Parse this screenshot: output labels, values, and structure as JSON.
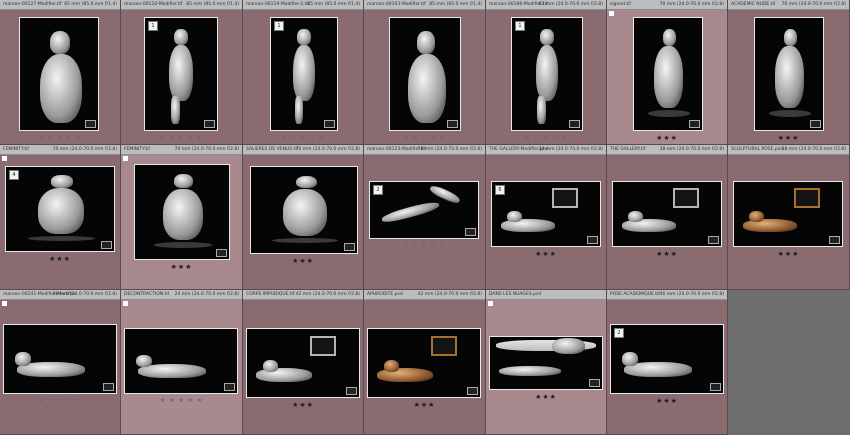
{
  "cells": [
    {
      "file": "maroon-00127-Modifier.tif",
      "lens": "85 mm (85.0 mm f/1.4)",
      "num": "",
      "stars": "★ ★ ★ ★ ★",
      "rated": false,
      "bg": "dark",
      "pose": "portrait"
    },
    {
      "file": "maroon-00110-Modifier.tif",
      "lens": "85 mm (85.0 mm f/1.4)",
      "num": "1",
      "stars": "★ ★ ★ ★ ★",
      "rated": false,
      "bg": "dark",
      "pose": "stool"
    },
    {
      "file": "maroon-00119-Modifier-2.tif",
      "lens": "85 mm (85.0 mm f/1.4)",
      "num": "1",
      "stars": "★ ★ ★ ★ ★",
      "rated": false,
      "bg": "dark",
      "pose": "seated"
    },
    {
      "file": "maroon-00103-Modifier.tif",
      "lens": "85 mm (85.0 mm f/1.4)",
      "num": "",
      "stars": "★ ★ ★ ★ ★",
      "rated": false,
      "bg": "dark",
      "pose": "portrait2"
    },
    {
      "file": "maroon-00186-Modifier.tif",
      "lens": "62 mm (24.0-70.0 mm f/2.8)",
      "num": "1",
      "stars": "★ ★ ★ ★ ★",
      "rated": false,
      "bg": "dark",
      "pose": "standing"
    },
    {
      "file": "signed.tif",
      "lens": "70 mm (24.0-70.0 mm f/2.8)",
      "num": "",
      "stars": "★★★",
      "rated": true,
      "bg": "light",
      "pose": "back"
    },
    {
      "file": "ACADEMIC NUDE.tif",
      "lens": "70 mm (24.0-70.0 mm f/2.8)",
      "num": "",
      "stars": "★★★",
      "rated": true,
      "bg": "dark",
      "pose": "back"
    },
    {
      "file": "FEMINITY.tif",
      "lens": "70 mm (24.0-70.0 mm f/2.8)",
      "num": "4",
      "stars": "★★★",
      "rated": true,
      "bg": "dark",
      "pose": "back2"
    },
    {
      "file": "FEMINITY.tif",
      "lens": "70 mm (24.0-70.0 mm f/2.8)",
      "num": "",
      "stars": "★★★",
      "rated": true,
      "bg": "light",
      "pose": "back2"
    },
    {
      "file": "SALIERES DE VENUS.tif",
      "lens": "70 mm (24.0-70.0 mm f/2.8)",
      "num": "",
      "stars": "★★★",
      "rated": true,
      "bg": "dark",
      "pose": "back2"
    },
    {
      "file": "maroon-00123-Modifier.tif",
      "lens": "78 mm (24.0-70.0 mm f/2.8)",
      "num": "2",
      "stars": "★ ★ ★ ★ ★",
      "rated": false,
      "bg": "dark",
      "pose": "legs"
    },
    {
      "file": "THE GALLERY-Modifier.psd",
      "lens": "38 mm (24.0-70.0 mm f/2.8)",
      "num": "6",
      "stars": "★★★",
      "rated": true,
      "bg": "dark",
      "pose": "gallery"
    },
    {
      "file": "THE GALLERY.tif",
      "lens": "38 mm (24.0-70.0 mm f/2.8)",
      "num": "",
      "stars": "★★★",
      "rated": true,
      "bg": "dark",
      "pose": "gallery"
    },
    {
      "file": "SCULPTURAL POSE.psd",
      "lens": "38 mm (24.0-70.0 mm f/2.8)",
      "num": "",
      "stars": "★★★",
      "rated": true,
      "bg": "dark",
      "pose": "goldgallery"
    },
    {
      "file": "maroon-00241-Modifier-Modifier.tif",
      "lens": "38 mm (24.0-70.0 mm f/2.8)",
      "num": "",
      "stars": "★ ★ ★ ★ ★",
      "rated": false,
      "bg": "dark",
      "pose": "reclining"
    },
    {
      "file": "DECONTRACTION.tif",
      "lens": "24 mm (24.0-70.0 mm f/2.8)",
      "num": "",
      "stars": "★ ★ ★ ★ ★",
      "rated": false,
      "bg": "light",
      "pose": "reclining"
    },
    {
      "file": "CORPS IMPUDIQUE.tif",
      "lens": "42 mm (24.0-70.0 mm f/2.8)",
      "num": "",
      "stars": "★★★",
      "rated": true,
      "bg": "dark",
      "pose": "gallery"
    },
    {
      "file": "APHRODITE.psd",
      "lens": "42 mm (24.0-70.0 mm f/2.8)",
      "num": "",
      "stars": "★★★",
      "rated": true,
      "bg": "dark",
      "pose": "goldgallery"
    },
    {
      "file": "DANS LES NUAGES.psd",
      "lens": "",
      "num": "",
      "stars": "★★★",
      "rated": true,
      "bg": "light",
      "pose": "clouds"
    },
    {
      "file": "POSE ACADEMIQUE.tif",
      "lens": "46 mm (24.0-70.0 mm f/2.8)",
      "num": "2",
      "stars": "★★★",
      "rated": true,
      "bg": "dark",
      "pose": "reclining2"
    }
  ]
}
